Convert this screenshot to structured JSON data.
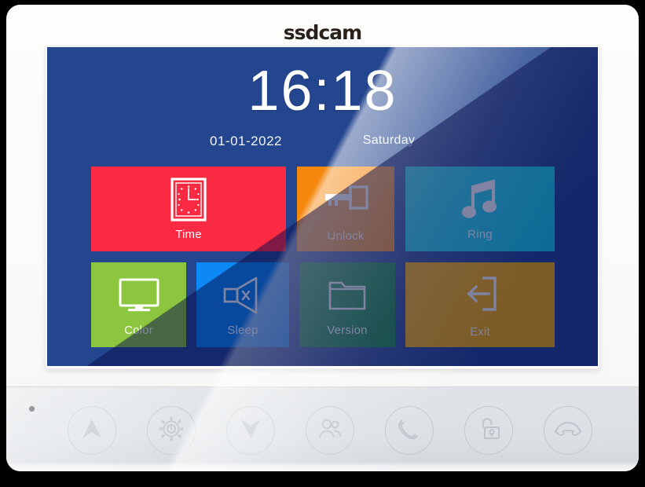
{
  "device": {
    "brand": "ssdcam",
    "led_name": "status-led"
  },
  "screen": {
    "background_color": "#24468f",
    "background_color_shadow": "#0b1566",
    "clock": {
      "time": "16:18",
      "date": "01-01-2022",
      "weekday": "Saturday"
    },
    "tiles": [
      {
        "key": "time",
        "label": "Time",
        "icon": "clock-icon",
        "color": "#f92a42"
      },
      {
        "key": "unlock",
        "label": "Unlock",
        "icon": "key-icon",
        "color": "#f5870d"
      },
      {
        "key": "ring",
        "label": "Ring",
        "icon": "music-note-icon",
        "color": "#17d3e8"
      },
      {
        "key": "color",
        "label": "Color",
        "icon": "monitor-icon",
        "color": "#8cc63e"
      },
      {
        "key": "sleep",
        "label": "Sleep",
        "icon": "speaker-mute-icon",
        "color": "#0d89f5"
      },
      {
        "key": "version",
        "label": "Version",
        "icon": "folder-icon",
        "color": "#0e8a39"
      },
      {
        "key": "exit",
        "label": "Exit",
        "icon": "exit-arrow-icon",
        "color": "#fcb300"
      }
    ]
  },
  "panel": {
    "background_color": "#dce1e5",
    "buttons": [
      {
        "key": "up",
        "icon": "chevron-up-icon"
      },
      {
        "key": "settings",
        "icon": "gear-power-icon"
      },
      {
        "key": "down",
        "icon": "chevron-down-icon"
      },
      {
        "key": "contacts",
        "icon": "two-people-icon"
      },
      {
        "key": "answer",
        "icon": "handset-answer-icon"
      },
      {
        "key": "unlock",
        "icon": "padlock-open-icon"
      },
      {
        "key": "hangup",
        "icon": "handset-hangup-icon"
      }
    ]
  }
}
